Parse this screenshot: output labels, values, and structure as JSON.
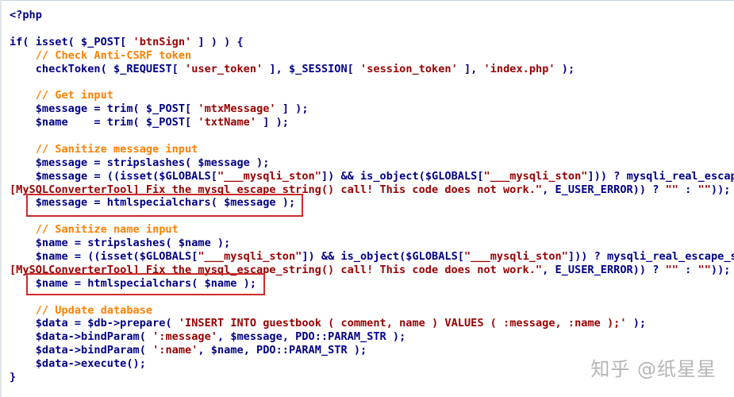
{
  "code": {
    "language": "php",
    "lines": [
      [
        [
          "p",
          "<?php"
        ]
      ],
      [],
      [
        [
          "kw",
          "if"
        ],
        [
          "p",
          "( "
        ],
        [
          "fn",
          "isset"
        ],
        [
          "p",
          "( "
        ],
        [
          "var",
          "$_POST"
        ],
        [
          "p",
          "[ "
        ],
        [
          "str",
          "'btnSign'"
        ],
        [
          "p",
          " ] ) ) {"
        ]
      ],
      [
        [
          "p",
          "    "
        ],
        [
          "cmt",
          "// Check Anti-CSRF token"
        ]
      ],
      [
        [
          "p",
          "    "
        ],
        [
          "fn",
          "checkToken"
        ],
        [
          "p",
          "( "
        ],
        [
          "var",
          "$_REQUEST"
        ],
        [
          "p",
          "[ "
        ],
        [
          "str",
          "'user_token'"
        ],
        [
          "p",
          " ], "
        ],
        [
          "var",
          "$_SESSION"
        ],
        [
          "p",
          "[ "
        ],
        [
          "str",
          "'session_token'"
        ],
        [
          "p",
          " ], "
        ],
        [
          "str",
          "'index.php'"
        ],
        [
          "p",
          " );"
        ]
      ],
      [],
      [
        [
          "p",
          "    "
        ],
        [
          "cmt",
          "// Get input"
        ]
      ],
      [
        [
          "p",
          "    "
        ],
        [
          "var",
          "$message"
        ],
        [
          "p",
          " = "
        ],
        [
          "fn",
          "trim"
        ],
        [
          "p",
          "( "
        ],
        [
          "var",
          "$_POST"
        ],
        [
          "p",
          "[ "
        ],
        [
          "str",
          "'mtxMessage'"
        ],
        [
          "p",
          " ] );"
        ]
      ],
      [
        [
          "p",
          "    "
        ],
        [
          "var",
          "$name"
        ],
        [
          "p",
          "    = "
        ],
        [
          "fn",
          "trim"
        ],
        [
          "p",
          "( "
        ],
        [
          "var",
          "$_POST"
        ],
        [
          "p",
          "[ "
        ],
        [
          "str",
          "'txtName'"
        ],
        [
          "p",
          " ] );"
        ]
      ],
      [],
      [
        [
          "p",
          "    "
        ],
        [
          "cmt",
          "// Sanitize message input"
        ]
      ],
      [
        [
          "p",
          "    "
        ],
        [
          "var",
          "$message"
        ],
        [
          "p",
          " = "
        ],
        [
          "fn",
          "stripslashes"
        ],
        [
          "p",
          "( "
        ],
        [
          "var",
          "$message"
        ],
        [
          "p",
          " );"
        ]
      ],
      [
        [
          "p",
          "    "
        ],
        [
          "var",
          "$message"
        ],
        [
          "p",
          " = (("
        ],
        [
          "fn",
          "isset"
        ],
        [
          "p",
          "("
        ],
        [
          "var",
          "$GLOBALS"
        ],
        [
          "p",
          "["
        ],
        [
          "str",
          "\"___mysqli_ston\""
        ],
        [
          "p",
          "]) && "
        ],
        [
          "fn",
          "is_object"
        ],
        [
          "p",
          "("
        ],
        [
          "var",
          "$GLOBALS"
        ],
        [
          "p",
          "["
        ],
        [
          "str",
          "\"___mysqli_ston\""
        ],
        [
          "p",
          "])) ? "
        ],
        [
          "fn",
          "mysqli_real_escape_string"
        ],
        [
          "p",
          "("
        ]
      ],
      [
        [
          "err",
          "[MySQLConverterTool] Fix the mysql_escape_string() call! This code does not work.\""
        ],
        [
          "p",
          ", E_USER_ERROR)) ? "
        ],
        [
          "str",
          "\"\""
        ],
        [
          "p",
          " : "
        ],
        [
          "str",
          "\"\""
        ],
        [
          "p",
          "));"
        ]
      ],
      [
        [
          "p",
          "    "
        ],
        [
          "var",
          "$message"
        ],
        [
          "p",
          " = "
        ],
        [
          "fn",
          "htmlspecialchars"
        ],
        [
          "p",
          "( "
        ],
        [
          "var",
          "$message"
        ],
        [
          "p",
          " );"
        ]
      ],
      [],
      [
        [
          "p",
          "    "
        ],
        [
          "cmt",
          "// Sanitize name input"
        ]
      ],
      [
        [
          "p",
          "    "
        ],
        [
          "var",
          "$name"
        ],
        [
          "p",
          " = "
        ],
        [
          "fn",
          "stripslashes"
        ],
        [
          "p",
          "( "
        ],
        [
          "var",
          "$name"
        ],
        [
          "p",
          " );"
        ]
      ],
      [
        [
          "p",
          "    "
        ],
        [
          "var",
          "$name"
        ],
        [
          "p",
          " = (("
        ],
        [
          "fn",
          "isset"
        ],
        [
          "p",
          "("
        ],
        [
          "var",
          "$GLOBALS"
        ],
        [
          "p",
          "["
        ],
        [
          "str",
          "\"___mysqli_ston\""
        ],
        [
          "p",
          "]) && "
        ],
        [
          "fn",
          "is_object"
        ],
        [
          "p",
          "("
        ],
        [
          "var",
          "$GLOBALS"
        ],
        [
          "p",
          "["
        ],
        [
          "str",
          "\"___mysqli_ston\""
        ],
        [
          "p",
          "])) ? "
        ],
        [
          "fn",
          "mysqli_real_escape_string"
        ],
        [
          "p",
          "("
        ]
      ],
      [
        [
          "err",
          "[MySQLConverterTool] Fix the mysql_escape_string() call! This code does not work.\""
        ],
        [
          "p",
          ", E_USER_ERROR)) ? "
        ],
        [
          "str",
          "\"\""
        ],
        [
          "p",
          " : "
        ],
        [
          "str",
          "\"\""
        ],
        [
          "p",
          "));"
        ]
      ],
      [
        [
          "p",
          "    "
        ],
        [
          "var",
          "$name"
        ],
        [
          "p",
          " = "
        ],
        [
          "fn",
          "htmlspecialchars"
        ],
        [
          "p",
          "( "
        ],
        [
          "var",
          "$name"
        ],
        [
          "p",
          " );"
        ]
      ],
      [],
      [
        [
          "p",
          "    "
        ],
        [
          "cmt",
          "// Update database"
        ]
      ],
      [
        [
          "p",
          "    "
        ],
        [
          "var",
          "$data"
        ],
        [
          "p",
          " = "
        ],
        [
          "var",
          "$db"
        ],
        [
          "p",
          "->"
        ],
        [
          "fn",
          "prepare"
        ],
        [
          "p",
          "( "
        ],
        [
          "str",
          "'INSERT INTO guestbook ( comment, name ) VALUES ( :message, :name );'"
        ],
        [
          "p",
          " );"
        ]
      ],
      [
        [
          "p",
          "    "
        ],
        [
          "var",
          "$data"
        ],
        [
          "p",
          "->"
        ],
        [
          "fn",
          "bindParam"
        ],
        [
          "p",
          "( "
        ],
        [
          "str",
          "':message'"
        ],
        [
          "p",
          ", "
        ],
        [
          "var",
          "$message"
        ],
        [
          "p",
          ", PDO::PARAM_STR );"
        ]
      ],
      [
        [
          "p",
          "    "
        ],
        [
          "var",
          "$data"
        ],
        [
          "p",
          "->"
        ],
        [
          "fn",
          "bindParam"
        ],
        [
          "p",
          "( "
        ],
        [
          "str",
          "':name'"
        ],
        [
          "p",
          ", "
        ],
        [
          "var",
          "$name"
        ],
        [
          "p",
          ", PDO::PARAM_STR );"
        ]
      ],
      [
        [
          "p",
          "    "
        ],
        [
          "var",
          "$data"
        ],
        [
          "p",
          "->"
        ],
        [
          "fn",
          "execute"
        ],
        [
          "p",
          "();"
        ]
      ],
      [
        [
          "p",
          "}"
        ]
      ]
    ]
  },
  "watermark": {
    "text": "知乎 @纸星星"
  },
  "colors": {
    "keyword": "#000088",
    "string": "#990000",
    "comment": "#ff8000",
    "highlight_border": "#cc2b2b"
  }
}
